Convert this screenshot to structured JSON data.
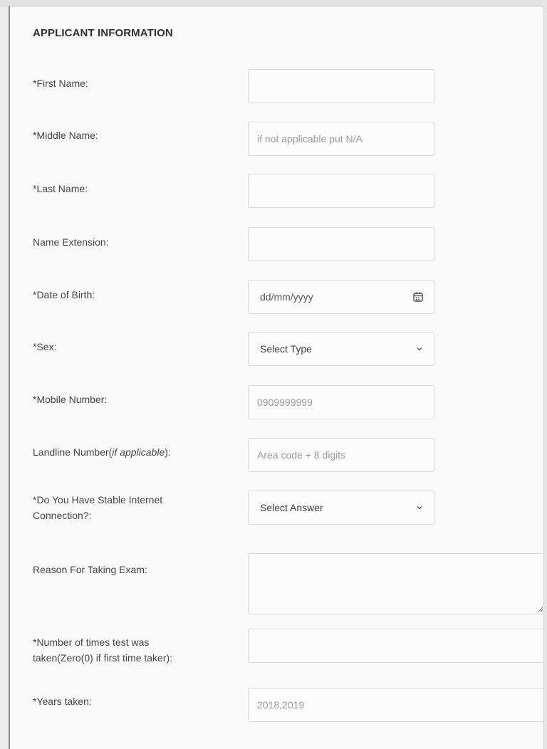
{
  "section": {
    "title": "APPLICANT INFORMATION"
  },
  "fields": {
    "first_name": {
      "label": "*First Name:",
      "value": "",
      "placeholder": ""
    },
    "middle_name": {
      "label": "*Middle Name:",
      "value": "",
      "placeholder": "if not applicable put N/A"
    },
    "last_name": {
      "label": "*Last Name:",
      "value": "",
      "placeholder": ""
    },
    "name_extension": {
      "label": "Name Extension:",
      "value": "",
      "placeholder": ""
    },
    "date_of_birth": {
      "label": "*Date of Birth:",
      "display": "dd/mm/yyyy",
      "icon": "calendar-icon"
    },
    "sex": {
      "label": "*Sex:",
      "selected": "Select Type",
      "icon": "chevron-down-icon"
    },
    "mobile_number": {
      "label": "*Mobile Number:",
      "value": "",
      "placeholder": "0909999999"
    },
    "landline_number": {
      "label_main": "Landline Number(",
      "label_italic": "if applicable",
      "label_end": "):",
      "value": "",
      "placeholder": "Area code + 8 digits"
    },
    "stable_internet": {
      "label_line1": "*Do You Have Stable Internet",
      "label_line2": "Connection?:",
      "selected": "Select Answer",
      "icon": "chevron-down-icon"
    },
    "reason_for_exam": {
      "label": "Reason For Taking Exam:",
      "value": "",
      "icon": "resize-grip-icon"
    },
    "times_taken": {
      "label_line1": "*Number of times test was",
      "label_line2": "taken(Zero(0) if first time taker):",
      "value": "",
      "placeholder": ""
    },
    "years_taken": {
      "label": "*Years taken:",
      "value": "",
      "placeholder": "2018,2019"
    }
  },
  "colors": {
    "card_background": "#fafafa",
    "input_border": "#d9d9d9",
    "placeholder_text": "#9a9a9a",
    "label_text": "#444444",
    "left_border": "#8d8d8d"
  }
}
